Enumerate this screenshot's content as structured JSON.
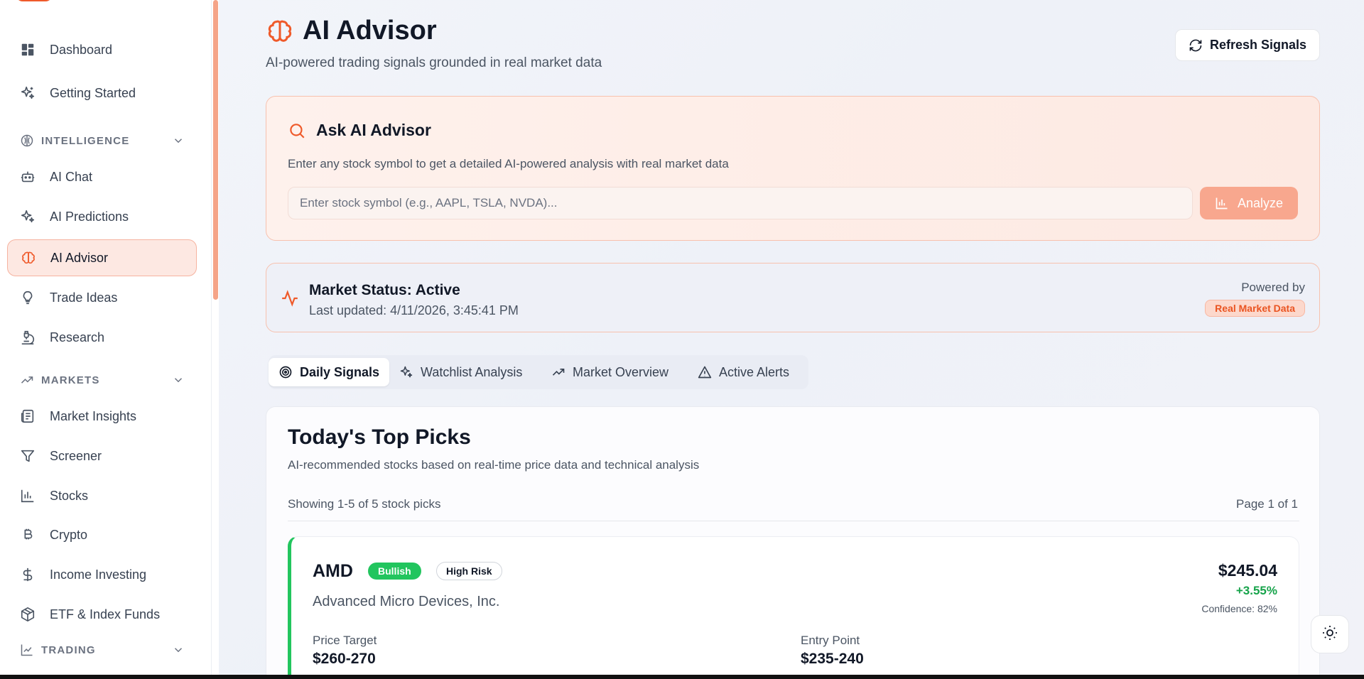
{
  "sidebar": {
    "items_top": [
      {
        "label": "Dashboard",
        "icon": "dashboard-icon"
      },
      {
        "label": "Getting Started",
        "icon": "sparkles-icon"
      }
    ],
    "sections": [
      {
        "title": "INTELLIGENCE",
        "icon": "globe-brain-icon",
        "items": [
          {
            "label": "AI Chat",
            "icon": "bot-icon"
          },
          {
            "label": "AI Predictions",
            "icon": "sparkles-icon"
          },
          {
            "label": "AI Advisor",
            "icon": "brain-icon",
            "active": true
          },
          {
            "label": "Trade Ideas",
            "icon": "lightbulb-icon"
          },
          {
            "label": "Research",
            "icon": "microscope-icon"
          }
        ]
      },
      {
        "title": "MARKETS",
        "icon": "trending-up-icon",
        "items": [
          {
            "label": "Market Insights",
            "icon": "newspaper-icon"
          },
          {
            "label": "Screener",
            "icon": "filter-icon"
          },
          {
            "label": "Stocks",
            "icon": "bar-chart-icon"
          },
          {
            "label": "Crypto",
            "icon": "bitcoin-icon"
          },
          {
            "label": "Income Investing",
            "icon": "dollar-icon"
          },
          {
            "label": "ETF & Index Funds",
            "icon": "package-icon"
          }
        ]
      },
      {
        "title": "TRADING",
        "icon": "line-chart-icon",
        "items": []
      }
    ]
  },
  "header": {
    "title": "AI Advisor",
    "subtitle": "AI-powered trading signals grounded in real market data",
    "refresh_label": "Refresh Signals"
  },
  "ask": {
    "title": "Ask AI Advisor",
    "description": "Enter any stock symbol to get a detailed AI-powered analysis with real market data",
    "placeholder": "Enter stock symbol (e.g., AAPL, TSLA, NVDA)...",
    "analyze_label": "Analyze"
  },
  "status": {
    "title": "Market Status: Active",
    "updated": "Last updated: 4/11/2026, 3:45:41 PM",
    "powered_by": "Powered by",
    "badge": "Real Market Data"
  },
  "tabs": [
    {
      "label": "Daily Signals",
      "active": true
    },
    {
      "label": "Watchlist Analysis"
    },
    {
      "label": "Market Overview"
    },
    {
      "label": "Active Alerts"
    }
  ],
  "picks": {
    "title": "Today's Top Picks",
    "description": "AI-recommended stocks based on real-time price data and technical analysis",
    "showing": "Showing 1-5 of 5 stock picks",
    "page": "Page 1 of 1",
    "items": [
      {
        "symbol": "AMD",
        "sentiment": "Bullish",
        "risk": "High Risk",
        "name": "Advanced Micro Devices, Inc.",
        "price": "$245.04",
        "change": "+3.55%",
        "confidence": "Confidence: 82%",
        "price_target_label": "Price Target",
        "price_target": "$260-270",
        "entry_label": "Entry Point",
        "entry": "$235-240"
      }
    ]
  },
  "colors": {
    "accent": "#ef5a2a",
    "bullish": "#22c55e",
    "positive_text": "#16a34a"
  }
}
